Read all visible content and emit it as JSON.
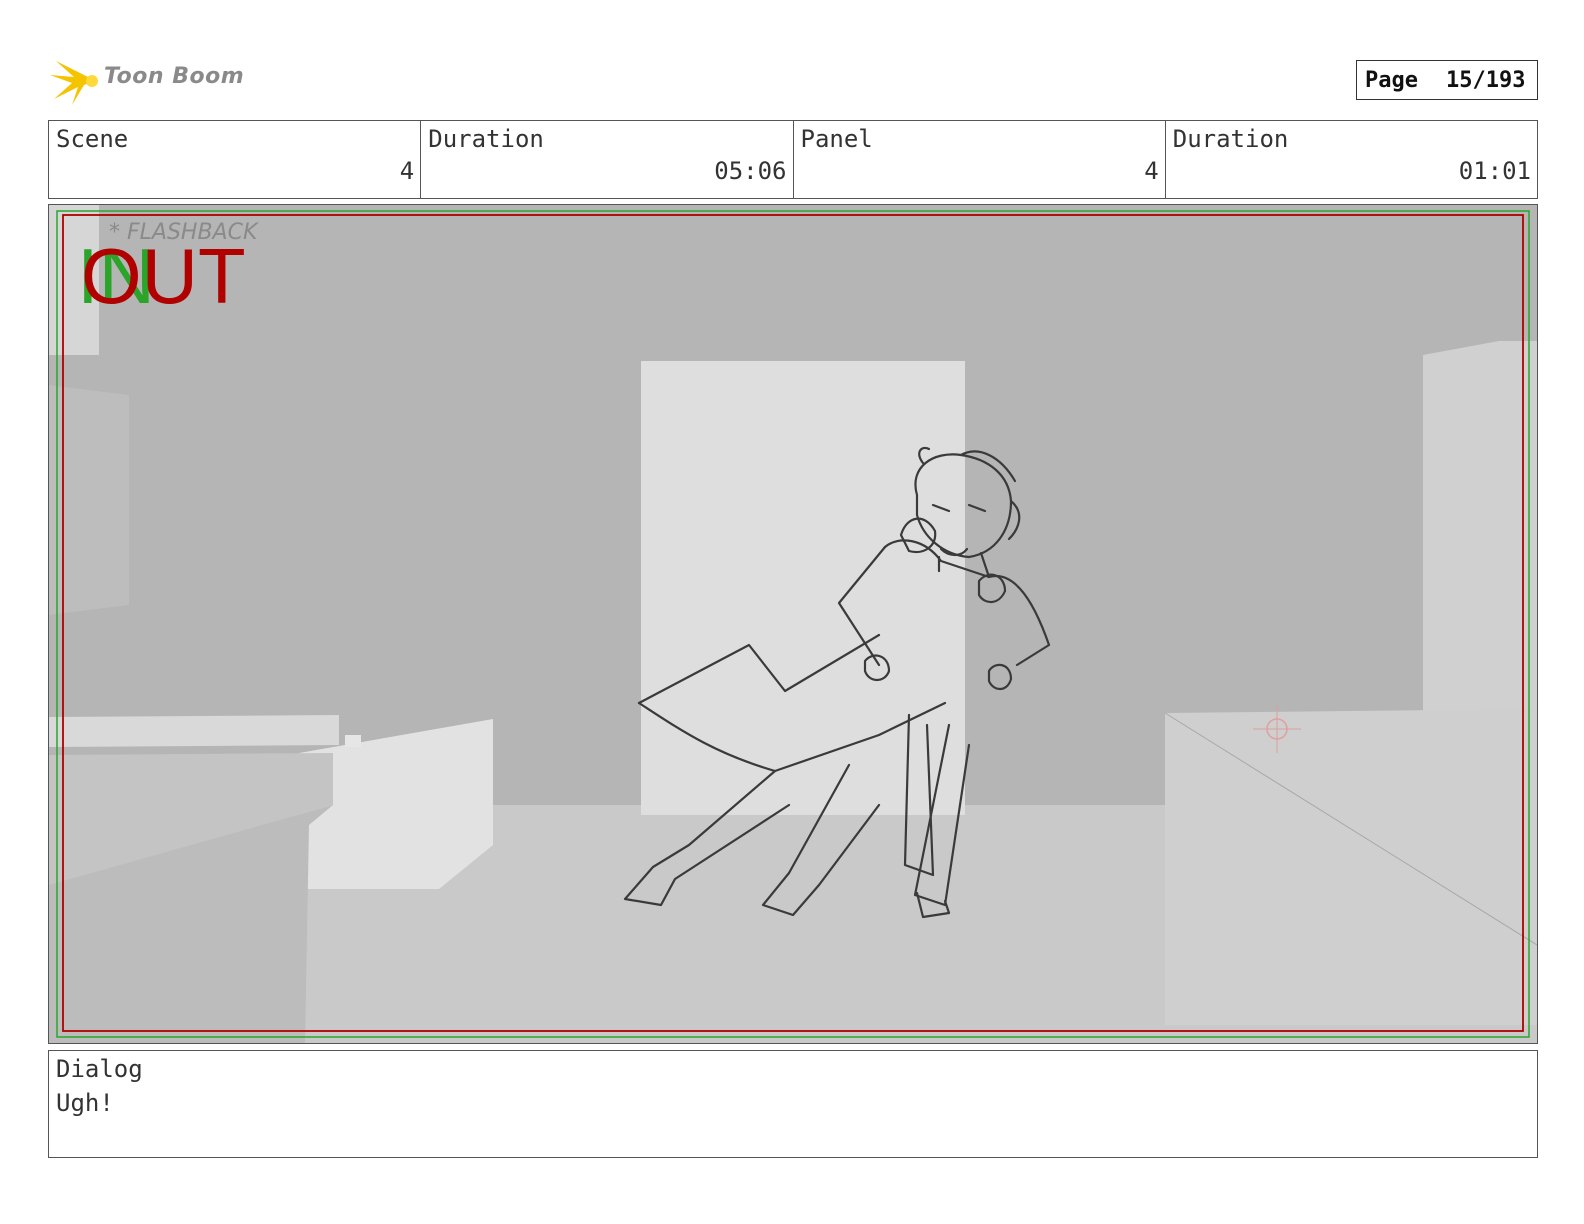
{
  "brand": {
    "name": "Toon Boom",
    "logo_icon": "starburst-icon",
    "accent": "#f5c400"
  },
  "page": {
    "label": "Page",
    "number": "15/193"
  },
  "header": {
    "scene_label": "Scene",
    "scene_value": "4",
    "scene_duration_label": "Duration",
    "scene_duration_value": "05:06",
    "panel_label": "Panel",
    "panel_value": "4",
    "panel_duration_label": "Duration",
    "panel_duration_value": "01:01"
  },
  "frame": {
    "annotation": "* FLASHBACK",
    "in_marker": "IN",
    "out_marker": "OUT",
    "in_color": "#2aa52a",
    "out_color": "#b00000"
  },
  "dialog": {
    "label": "Dialog",
    "text": "Ugh!"
  }
}
